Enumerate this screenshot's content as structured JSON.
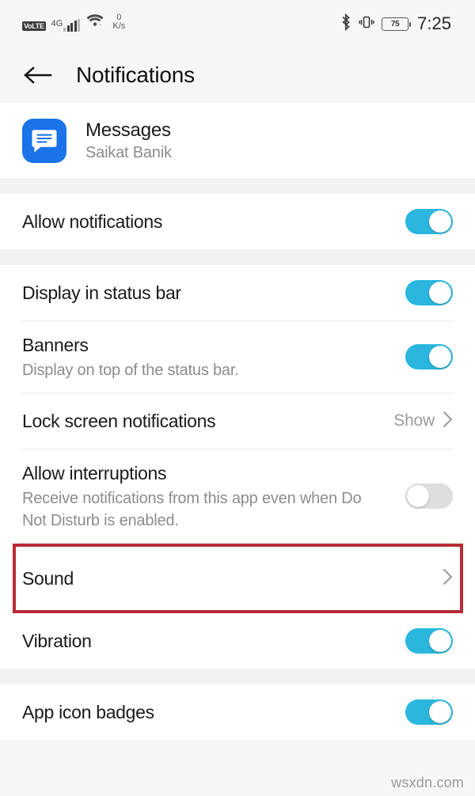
{
  "statusbar": {
    "volte_label": "VoLTE",
    "network_gen": "4G",
    "data_rate_value": "0",
    "data_rate_unit": "K/s",
    "battery_percent": "75",
    "time": "7:25",
    "icons": [
      "volte-icon",
      "signal-bars-icon",
      "wifi-icon",
      "bluetooth-icon",
      "vibrate-icon",
      "battery-icon"
    ]
  },
  "header": {
    "back_label": "back-arrow",
    "title": "Notifications"
  },
  "app": {
    "name": "Messages",
    "account": "Saikat Banik",
    "icon_color": "#1a73e8"
  },
  "colors": {
    "toggle_on": "#2ab6dd",
    "toggle_off": "#dedede",
    "highlight": "#b92a35"
  },
  "sections": [
    {
      "rows": [
        {
          "label": "Allow notifications",
          "sub": "",
          "control": "toggle",
          "state": "on"
        }
      ]
    },
    {
      "rows": [
        {
          "label": "Display in status bar",
          "sub": "",
          "control": "toggle",
          "state": "on"
        },
        {
          "label": "Banners",
          "sub": "Display on top of the status bar.",
          "control": "toggle",
          "state": "on"
        },
        {
          "label": "Lock screen notifications",
          "sub": "",
          "control": "value",
          "value": "Show"
        },
        {
          "label": "Allow interruptions",
          "sub": "Receive notifications from this app even when Do Not Disturb is enabled.",
          "control": "toggle",
          "state": "off"
        },
        {
          "label": "Sound",
          "sub": "",
          "control": "chevron",
          "highlighted": true
        },
        {
          "label": "Vibration",
          "sub": "",
          "control": "toggle",
          "state": "on"
        }
      ]
    },
    {
      "rows": [
        {
          "label": "App icon badges",
          "sub": "",
          "control": "toggle",
          "state": "on"
        }
      ]
    }
  ],
  "watermark": "wsxdn.com"
}
